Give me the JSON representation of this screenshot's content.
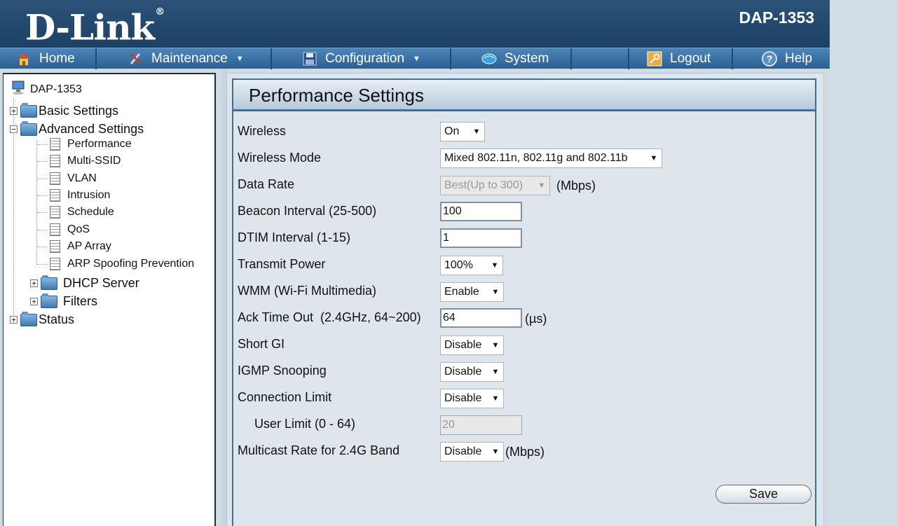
{
  "header": {
    "brand": "D-Link",
    "brand_mark": "®",
    "model": "DAP-1353"
  },
  "menu": [
    {
      "label": "Home",
      "icon": "home-icon",
      "has_dropdown": false
    },
    {
      "label": "Maintenance",
      "icon": "tools-icon",
      "has_dropdown": true
    },
    {
      "label": "Configuration",
      "icon": "disk-icon",
      "has_dropdown": true
    },
    {
      "label": "System",
      "icon": "globe-icon",
      "has_dropdown": false
    },
    {
      "label": "Logout",
      "icon": "key-icon",
      "has_dropdown": false
    },
    {
      "label": "Help",
      "icon": "help-icon",
      "has_dropdown": false
    }
  ],
  "tree": {
    "root": "DAP-1353",
    "basic": "Basic Settings",
    "advanced": "Advanced Settings",
    "advanced_items": [
      "Performance",
      "Multi-SSID",
      "VLAN",
      "Intrusion",
      "Schedule",
      "QoS",
      "AP Array",
      "ARP Spoofing Prevention"
    ],
    "dhcp": "DHCP Server",
    "filters": "Filters",
    "status": "Status"
  },
  "panel": {
    "title": "Performance Settings",
    "wireless": {
      "label": "Wireless",
      "value": "On"
    },
    "wireless_mode": {
      "label": "Wireless Mode",
      "value": "Mixed 802.11n, 802.11g and 802.11b"
    },
    "data_rate": {
      "label": "Data Rate",
      "value": "Best(Up to 300)",
      "unit": "(Mbps)"
    },
    "beacon": {
      "label": "Beacon Interval (25-500)",
      "value": "100"
    },
    "dtim": {
      "label": "DTIM Interval (1-15)",
      "value": "1"
    },
    "tx_power": {
      "label": "Transmit Power",
      "value": "100%"
    },
    "wmm": {
      "label": "WMM (Wi-Fi Multimedia)",
      "value": "Enable"
    },
    "ack": {
      "label": "Ack Time Out  (2.4GHz, 64~200)",
      "value": "64",
      "unit": "(µs)"
    },
    "short_gi": {
      "label": "Short GI",
      "value": "Disable"
    },
    "igmp": {
      "label": "IGMP Snooping",
      "value": "Disable"
    },
    "conn_limit": {
      "label": "Connection Limit",
      "value": "Disable"
    },
    "user_limit": {
      "label": "User Limit (0 - 64)",
      "value": "20"
    },
    "multicast": {
      "label": "Multicast Rate for 2.4G Band",
      "value": "Disable",
      "unit": "(Mbps)"
    },
    "save_label": "Save"
  }
}
